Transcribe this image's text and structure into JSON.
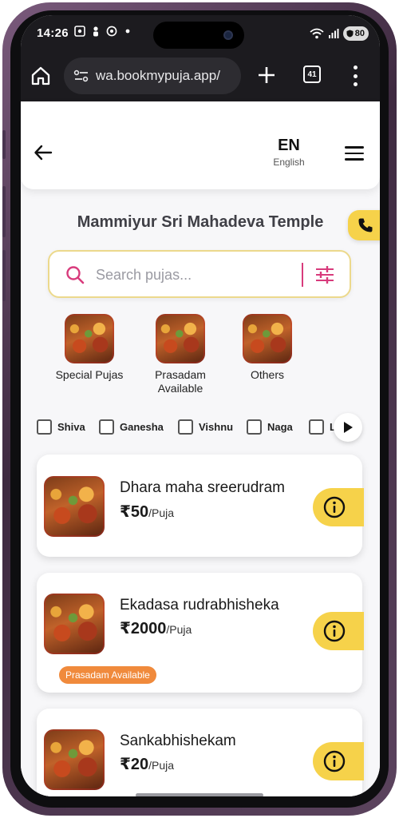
{
  "status_bar": {
    "time": "14:26",
    "battery": "80"
  },
  "browser": {
    "url": "wa.bookmypuja.app/",
    "tab_count": "41"
  },
  "header": {
    "lang_code": "EN",
    "lang_name": "English"
  },
  "temple_name": "Mammiyur Sri Mahadeva Temple",
  "search": {
    "placeholder": "Search pujas..."
  },
  "categories": [
    {
      "label": "Special Pujas"
    },
    {
      "label": "Prasadam Available"
    },
    {
      "label": "Others"
    }
  ],
  "filters": [
    {
      "label": "Shiva"
    },
    {
      "label": "Ganesha"
    },
    {
      "label": "Vishnu"
    },
    {
      "label": "Naga"
    },
    {
      "label": "L"
    }
  ],
  "pujas": [
    {
      "name": "Dhara maha sreerudram",
      "price": "₹50",
      "unit": "/Puja"
    },
    {
      "name": "Ekadasa rudrabhisheka",
      "price": "₹2000",
      "unit": "/Puja",
      "badge": "Prasadam Available"
    },
    {
      "name": "Sankabhishekam",
      "price": "₹20",
      "unit": "/Puja"
    }
  ],
  "colors": {
    "accent_yellow": "#f6d24a",
    "badge_orange": "#f08a3c",
    "search_border": "#ecd98c",
    "pink": "#d83b7c"
  }
}
